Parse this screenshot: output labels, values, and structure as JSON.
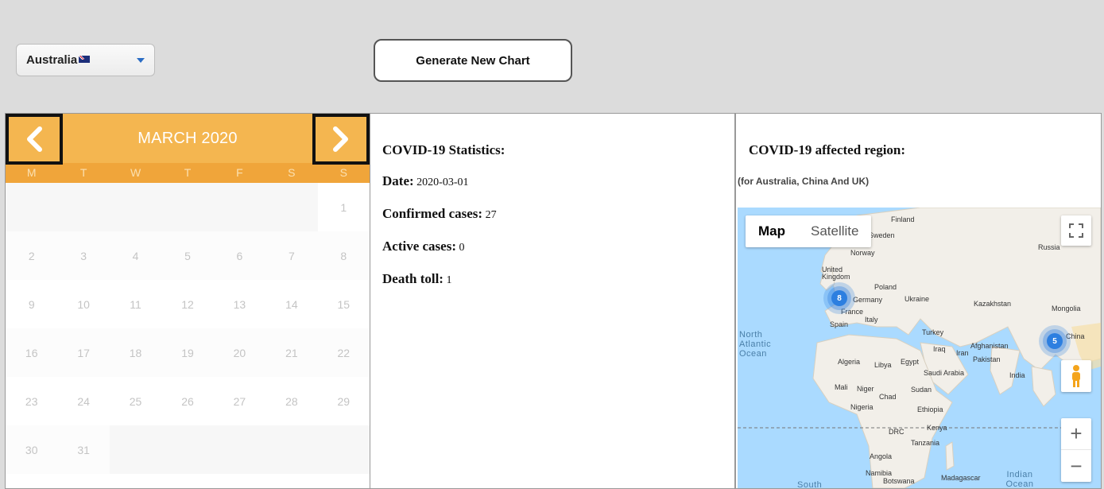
{
  "controls": {
    "country": "Australia",
    "generate_button": "Generate New Chart"
  },
  "calendar": {
    "title": "MARCH 2020",
    "weekdays": [
      "M",
      "T",
      "W",
      "T",
      "F",
      "S",
      "S"
    ],
    "first_weekday_index": 6,
    "days": [
      "1",
      "2",
      "3",
      "4",
      "5",
      "6",
      "7",
      "8",
      "9",
      "10",
      "11",
      "12",
      "13",
      "14",
      "15",
      "16",
      "17",
      "18",
      "19",
      "20",
      "21",
      "22",
      "23",
      "24",
      "25",
      "26",
      "27",
      "28",
      "29",
      "30",
      "31"
    ]
  },
  "stats": {
    "heading": "COVID-19 Statistics:",
    "date_label": "Date:",
    "date_value": "2020-03-01",
    "confirmed_label": "Confirmed cases:",
    "confirmed_value": "27",
    "active_label": "Active cases:",
    "active_value": "0",
    "deaths_label": "Death toll:",
    "deaths_value": "1"
  },
  "region": {
    "heading": "COVID-19 affected region:",
    "subheading": "(for Australia, China And UK)",
    "map": {
      "type_map": "Map",
      "type_satellite": "Satellite",
      "zoom_in": "+",
      "zoom_out": "−",
      "clusters": [
        {
          "name": "europe-cluster",
          "count": "8"
        },
        {
          "name": "china-cluster",
          "count": "5"
        }
      ],
      "labels": [
        "Finland",
        "Sweden",
        "Norway",
        "Russia",
        "United Kingdom",
        "Poland",
        "Germany",
        "Ukraine",
        "Kazakhstan",
        "Mongolia",
        "France",
        "Italy",
        "Spain",
        "Turkey",
        "China",
        "Iraq",
        "Iran",
        "Afghanistan",
        "Pakistan",
        "India",
        "Algeria",
        "Libya",
        "Egypt",
        "Saudi Arabia",
        "Mali",
        "Niger",
        "Chad",
        "Sudan",
        "Nigeria",
        "Ethiopia",
        "DRC",
        "Kenya",
        "Tanzania",
        "Angola",
        "Namibia",
        "Botswana",
        "Madagascar"
      ],
      "oceans": [
        "North Atlantic Ocean",
        "Indian Ocean",
        "South"
      ]
    }
  }
}
